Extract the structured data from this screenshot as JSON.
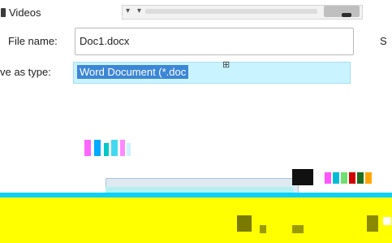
{
  "location": {
    "label": "Videos"
  },
  "file_name": {
    "label": "File name:",
    "value": "Doc1.docx"
  },
  "save_as_type": {
    "label": "ve as type:",
    "value": "Word Document (*.doc"
  },
  "side_label": "S",
  "colors": {
    "selection": "#3c86d6",
    "field_tint": "#c9f3ff",
    "bottom_bar": "#ffff00"
  },
  "icons": [
    "folder-icon",
    "dropdown-caret-icon"
  ]
}
